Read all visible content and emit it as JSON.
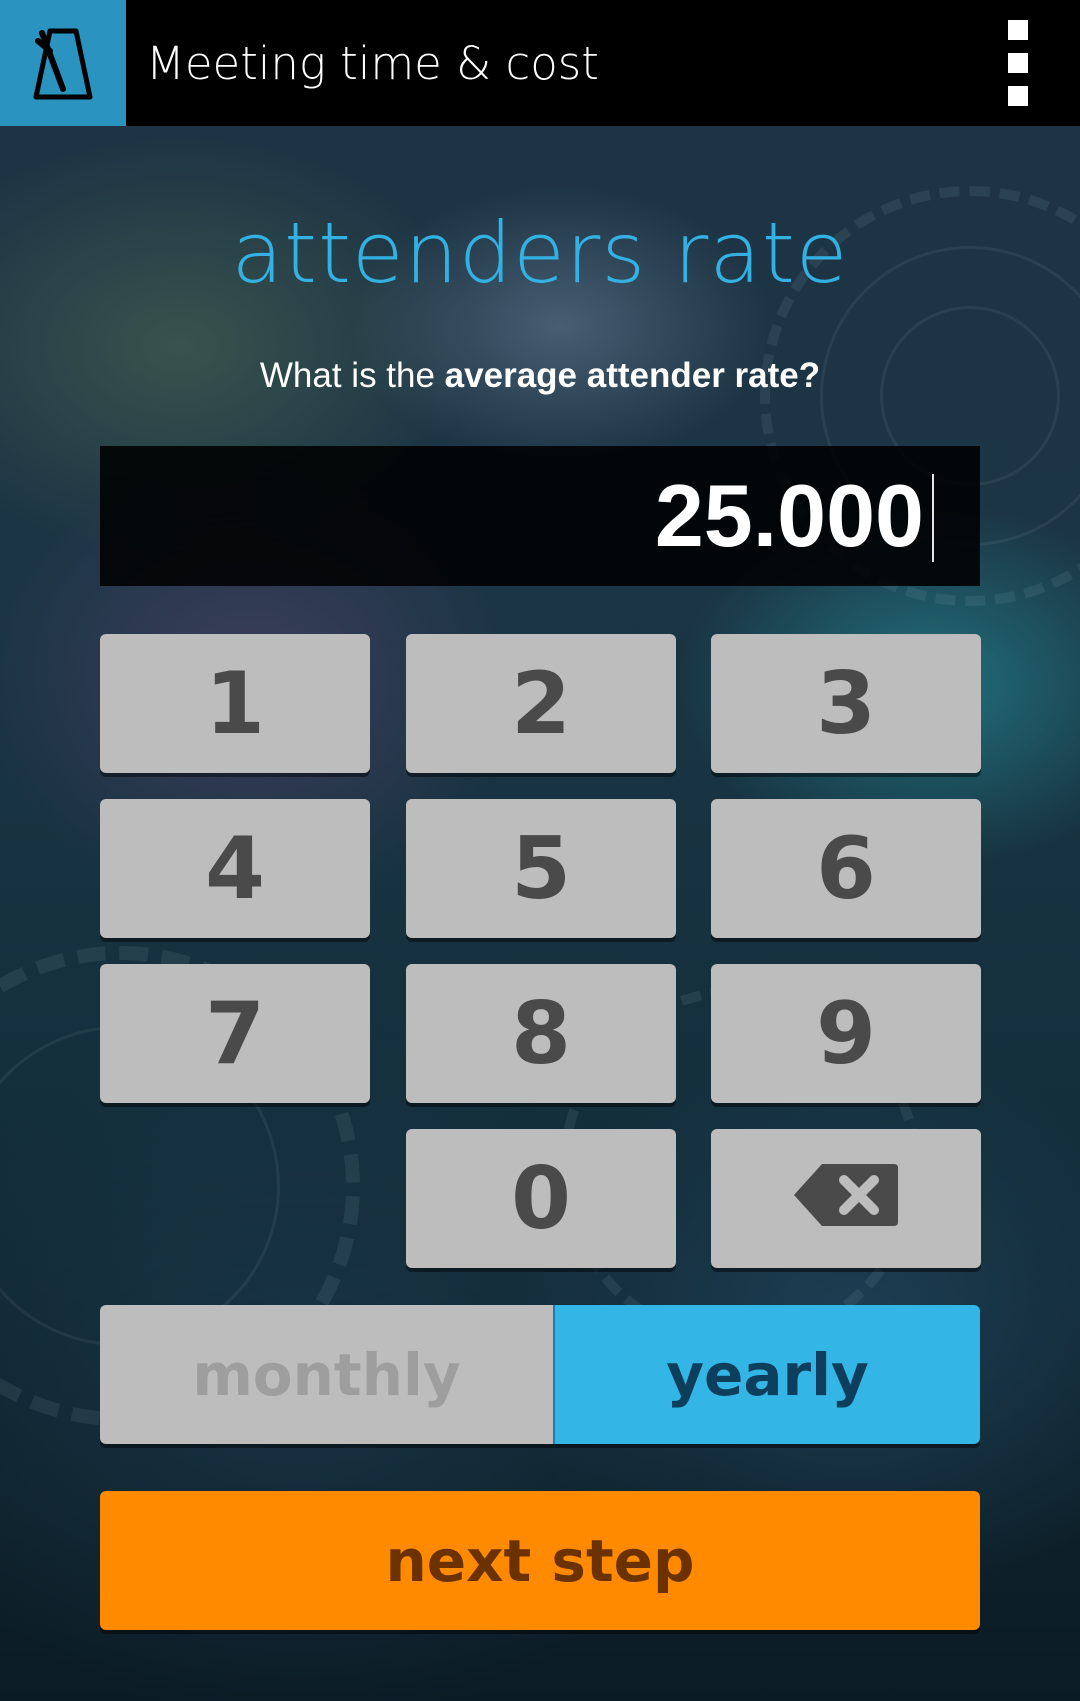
{
  "app": {
    "title": "Meeting time & cost",
    "logo_icon": "metronome-icon",
    "menu_icon": "overflow-menu-icon",
    "accent_color": "#2a93bf"
  },
  "screen": {
    "title": "attenders rate",
    "question_prefix": "What is the ",
    "question_bold": "average attender rate?"
  },
  "amount": {
    "value": "25.000"
  },
  "keypad": {
    "keys": [
      "1",
      "2",
      "3",
      "4",
      "5",
      "6",
      "7",
      "8",
      "9",
      "0"
    ],
    "backspace_icon": "backspace-icon"
  },
  "period_toggle": {
    "monthly_label": "monthly",
    "yearly_label": "yearly",
    "selected": "yearly",
    "selected_color": "#33b5e5"
  },
  "actions": {
    "next_label": "next step",
    "next_color": "#ff8a00"
  }
}
